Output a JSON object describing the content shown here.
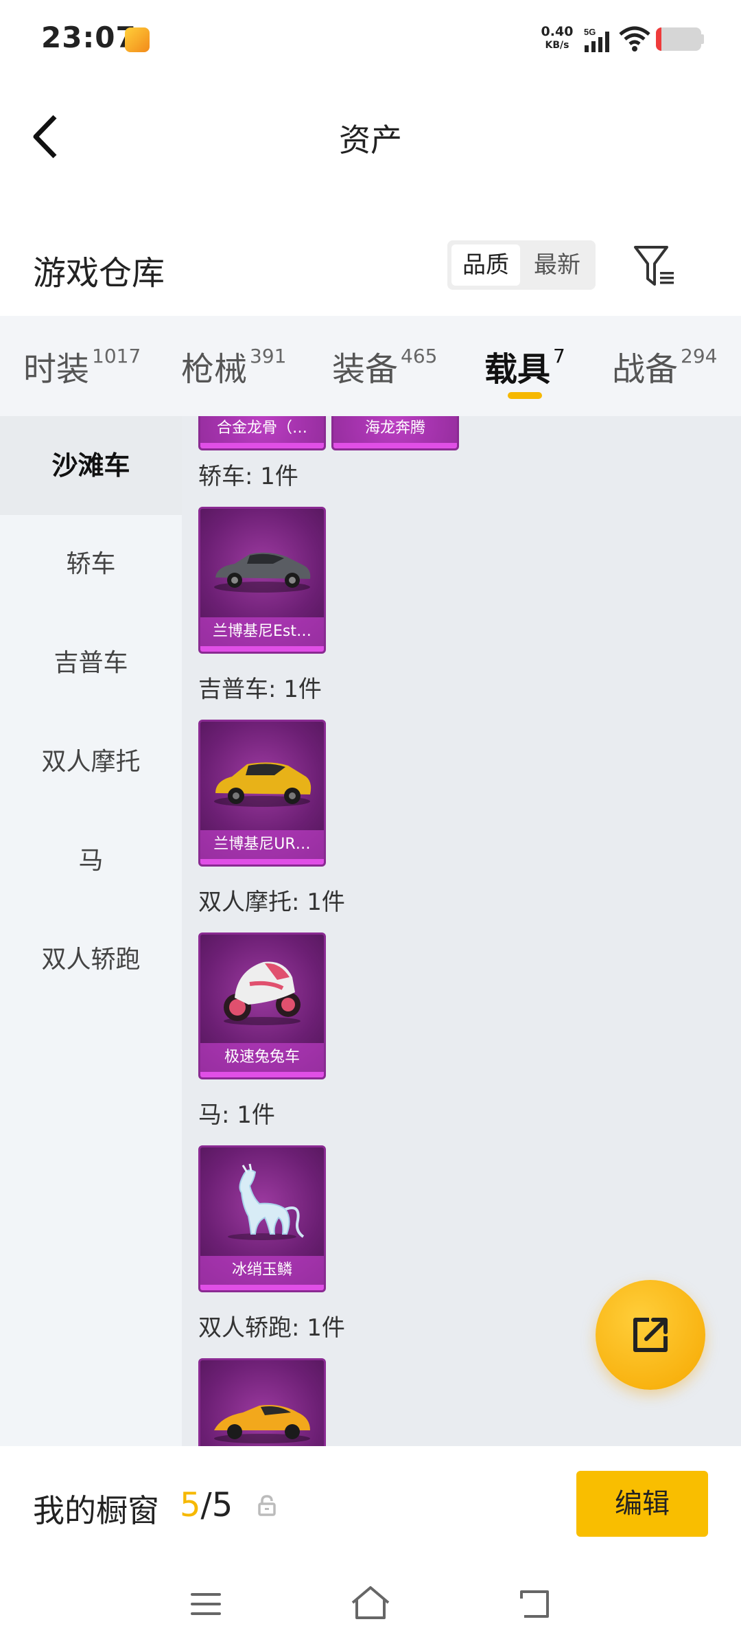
{
  "status_bar": {
    "time": "23:07",
    "net_speed_value": "0.40",
    "net_speed_unit": "KB/s",
    "network": "5G",
    "battery_color": "#ef3b3b"
  },
  "header": {
    "title": "资产"
  },
  "warehouse": {
    "title": "游戏仓库",
    "sort_options": [
      "品质",
      "最新"
    ],
    "sort_selected": "品质"
  },
  "tabs": [
    {
      "label": "时装",
      "count": "1017"
    },
    {
      "label": "枪械",
      "count": "391"
    },
    {
      "label": "装备",
      "count": "465"
    },
    {
      "label": "载具",
      "count": "7",
      "active": true
    },
    {
      "label": "战备",
      "count": "294"
    }
  ],
  "sidebar": {
    "items": [
      "沙滩车",
      "轿车",
      "吉普车",
      "双人摩托",
      "马",
      "双人轿跑"
    ],
    "selected": "沙滩车"
  },
  "content": {
    "top_partial_cards": [
      "合金龙骨（…",
      "海龙奔腾"
    ],
    "groups": [
      {
        "title": "轿车: 1件",
        "items": [
          "兰博基尼Est…"
        ]
      },
      {
        "title": "吉普车: 1件",
        "items": [
          "兰博基尼UR…"
        ]
      },
      {
        "title": "双人摩托: 1件",
        "items": [
          "极速兔兔车"
        ]
      },
      {
        "title": "马: 1件",
        "items": [
          "冰绡玉鳞"
        ]
      },
      {
        "title": "双人轿跑: 1件",
        "items": [
          ""
        ]
      }
    ]
  },
  "bottom_bar": {
    "window_label": "我的橱窗",
    "window_current": "5",
    "window_sep_total": "/5",
    "edit_label": "编辑",
    "accent_color": "#f6b800"
  }
}
